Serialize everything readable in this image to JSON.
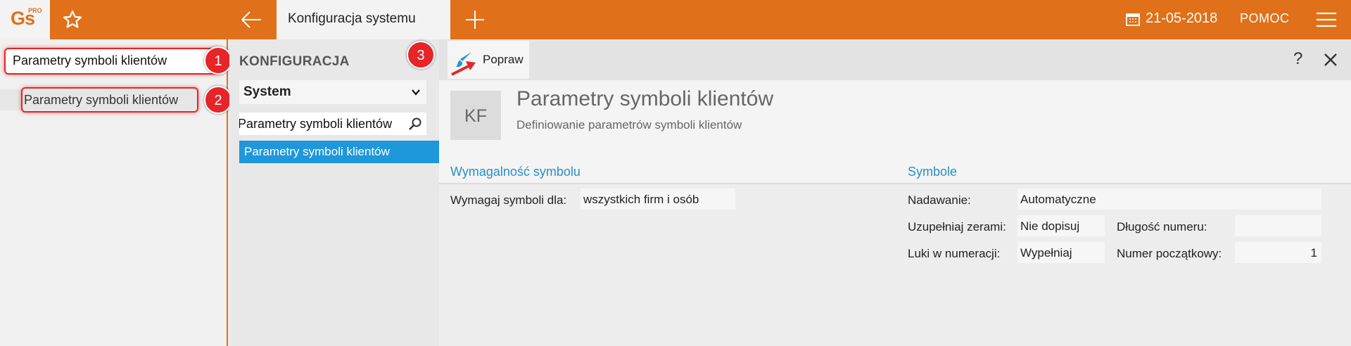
{
  "topbar": {
    "logo_text": "Gs",
    "logo_badge": "PRO",
    "active_tab": "Konfiguracja systemu",
    "date": "21-05-2018",
    "help": "POMOC"
  },
  "sidebar": {
    "search_value": "Parametry symboli klientów",
    "result": "Parametry symboli klientów"
  },
  "config": {
    "title": "KONFIGURACJA",
    "select_value": "System",
    "search_value": "Parametry symboli klientów",
    "selected_item": "Parametry symboli klientów"
  },
  "toolbar": {
    "edit_label": "Popraw",
    "help_label": "?"
  },
  "header": {
    "badge": "KF",
    "title": "Parametry symboli klientów",
    "subtitle": "Definiowanie parametrów symboli klientów"
  },
  "requirement": {
    "title": "Wymagalność symbolu",
    "label": "Wymagaj symboli dla:",
    "value": "wszystkich firm i osób"
  },
  "symbols": {
    "title": "Symbole",
    "assign_label": "Nadawanie:",
    "assign_value": "Automatyczne",
    "zeros_label": "Uzupełniaj zerami:",
    "zeros_value": "Nie dopisuj",
    "length_label": "Długość numeru:",
    "length_value": "",
    "gaps_label": "Luki w numeracji:",
    "gaps_value": "Wypełniaj",
    "start_label": "Numer początkowy:",
    "start_value": "1"
  },
  "callouts": [
    "1",
    "2",
    "3"
  ],
  "colors": {
    "accent": "#e07019",
    "selection": "#1f97db",
    "section_title": "#2a8ec6",
    "callout": "#e52528"
  }
}
